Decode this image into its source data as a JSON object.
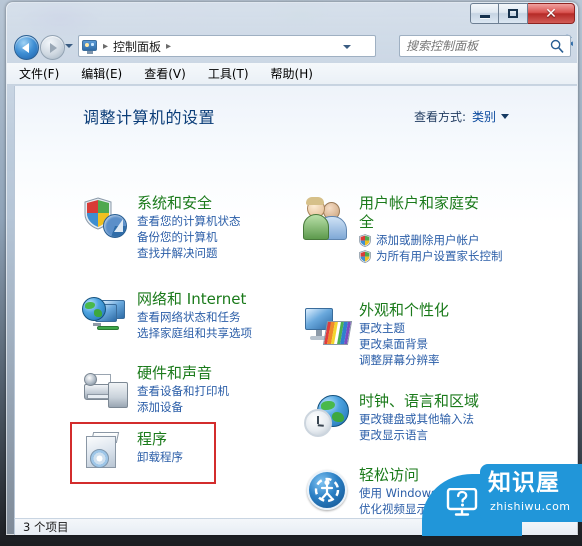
{
  "window": {
    "caption_buttons": {
      "minimize": "–",
      "maximize": "□",
      "close": "✕"
    }
  },
  "navbar": {
    "back_tooltip": "后退",
    "forward_tooltip": "前进",
    "breadcrumb": [
      "控制面板"
    ],
    "separator": "▸",
    "refresh_glyph": "↻",
    "address_icon": "control-panel-icon"
  },
  "search": {
    "placeholder": "搜索控制面板",
    "value": "",
    "icon": "search-icon"
  },
  "menubar": {
    "items": [
      {
        "label": "文件(F)"
      },
      {
        "label": "编辑(E)"
      },
      {
        "label": "查看(V)"
      },
      {
        "label": "工具(T)"
      },
      {
        "label": "帮助(H)"
      }
    ]
  },
  "main": {
    "title": "调整计算机的设置",
    "view_by_label": "查看方式:",
    "view_by_value": "类别"
  },
  "categories": {
    "left": [
      {
        "title": "系统和安全",
        "icon": "security-shield-icon",
        "links": [
          "查看您的计算机状态",
          "备份您的计算机",
          "查找并解决问题"
        ]
      },
      {
        "title": "网络和 Internet",
        "icon": "network-globe-icon",
        "links": [
          "查看网络状态和任务",
          "选择家庭组和共享选项"
        ]
      },
      {
        "title": "硬件和声音",
        "icon": "printer-speaker-icon",
        "links": [
          "查看设备和打印机",
          "添加设备"
        ]
      },
      {
        "title": "程序",
        "icon": "programs-cd-icon",
        "links": [
          "卸载程序"
        ],
        "highlighted": true
      }
    ],
    "right": [
      {
        "title": "用户帐户和家庭安全",
        "icon": "user-accounts-icon",
        "links": [
          "添加或删除用户帐户",
          "为所有用户设置家长控制"
        ],
        "link_shields": [
          true,
          true
        ]
      },
      {
        "title": "外观和个性化",
        "icon": "appearance-palette-icon",
        "links": [
          "更改主题",
          "更改桌面背景",
          "调整屏幕分辨率"
        ]
      },
      {
        "title": "时钟、语言和区域",
        "icon": "clock-globe-icon",
        "links": [
          "更改键盘或其他输入法",
          "更改显示语言"
        ]
      },
      {
        "title": "轻松访问",
        "icon": "ease-of-access-icon",
        "links": [
          "使用 Windows 建议的设置",
          "优化视频显示"
        ]
      }
    ]
  },
  "statusbar": {
    "text": "3 个项目"
  },
  "watermark": {
    "name": "知识屋",
    "url": "zhishiwu.com",
    "color": "#2196d9",
    "icon": "monitor-question-icon"
  },
  "colors": {
    "category_title": "#1a7a1a",
    "link": "#2b5ea8",
    "page_title": "#0b3d78",
    "highlight_box": "#d32c2c"
  }
}
